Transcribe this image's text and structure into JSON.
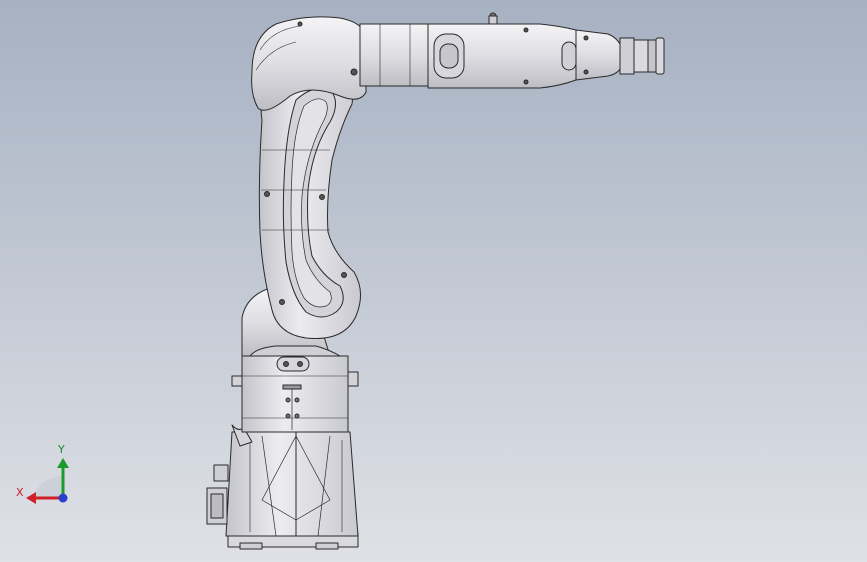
{
  "viewport": {
    "background_top": "#a6b1c2",
    "background_bottom": "#dfe1e6"
  },
  "model": {
    "body_color": "#e6e6ea",
    "edge_color": "#2a2a2a",
    "shade_color": "#b9b9c0"
  },
  "triad": {
    "x_label": "X",
    "y_label": "Y",
    "x_color": "#d01f26",
    "y_color": "#1e9a2b",
    "z_color": "#2a3fd0"
  }
}
